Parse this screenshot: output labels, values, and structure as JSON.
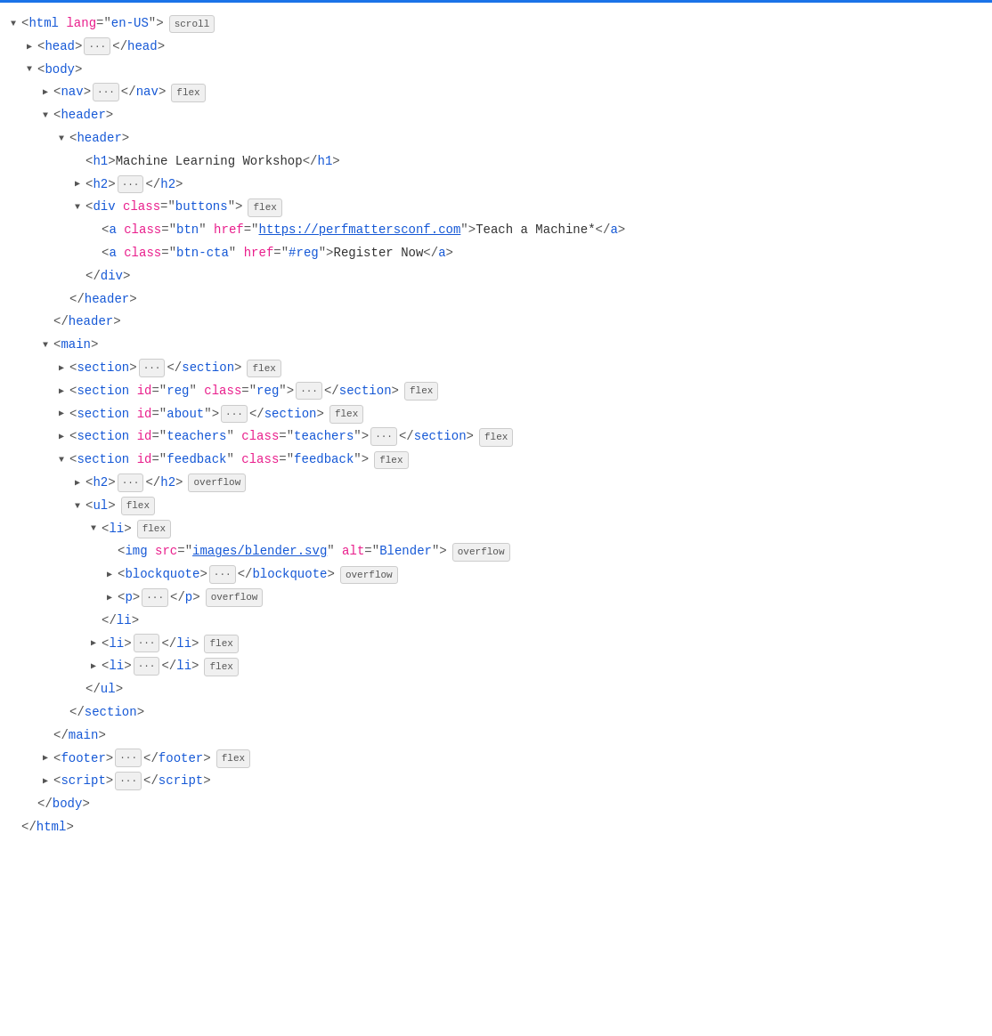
{
  "tree": {
    "lines": [
      {
        "id": "line-html",
        "indent": 0,
        "toggle": "down",
        "content": "html_open",
        "badge": "scroll"
      },
      {
        "id": "line-head",
        "indent": 1,
        "toggle": "right",
        "content": "head"
      },
      {
        "id": "line-body-open",
        "indent": 1,
        "toggle": "down",
        "content": "body_open"
      },
      {
        "id": "line-nav",
        "indent": 2,
        "toggle": "right",
        "content": "nav",
        "badge": "flex"
      },
      {
        "id": "line-outer-header-open",
        "indent": 2,
        "toggle": "down",
        "content": "outer_header_open"
      },
      {
        "id": "line-inner-header-open",
        "indent": 3,
        "toggle": "down",
        "content": "inner_header_open"
      },
      {
        "id": "line-h1",
        "indent": 4,
        "toggle": "none",
        "content": "h1"
      },
      {
        "id": "line-h2-collapsed",
        "indent": 4,
        "toggle": "right",
        "content": "h2_collapsed"
      },
      {
        "id": "line-div-buttons",
        "indent": 4,
        "toggle": "down",
        "content": "div_buttons",
        "badge": "flex"
      },
      {
        "id": "line-a-btn",
        "indent": 5,
        "toggle": "none",
        "content": "a_btn"
      },
      {
        "id": "line-a-btncta",
        "indent": 5,
        "toggle": "none",
        "content": "a_btncta"
      },
      {
        "id": "line-div-close",
        "indent": 4,
        "toggle": "none",
        "content": "div_close"
      },
      {
        "id": "line-inner-header-close",
        "indent": 3,
        "toggle": "none",
        "content": "inner_header_close"
      },
      {
        "id": "line-outer-header-close",
        "indent": 2,
        "toggle": "none",
        "content": "outer_header_close"
      },
      {
        "id": "line-main-open",
        "indent": 2,
        "toggle": "down",
        "content": "main_open"
      },
      {
        "id": "line-section1",
        "indent": 3,
        "toggle": "right",
        "content": "section1",
        "badge": "flex"
      },
      {
        "id": "line-section-reg",
        "indent": 3,
        "toggle": "right",
        "content": "section_reg",
        "badge": "flex"
      },
      {
        "id": "line-section-about",
        "indent": 3,
        "toggle": "right",
        "content": "section_about",
        "badge": "flex"
      },
      {
        "id": "line-section-teachers",
        "indent": 3,
        "toggle": "right",
        "content": "section_teachers",
        "badge": "flex"
      },
      {
        "id": "line-section-feedback",
        "indent": 3,
        "toggle": "down",
        "content": "section_feedback",
        "badge": "flex"
      },
      {
        "id": "line-h2-feedback",
        "indent": 4,
        "toggle": "right",
        "content": "h2_feedback",
        "badge": "overflow"
      },
      {
        "id": "line-ul",
        "indent": 4,
        "toggle": "down",
        "content": "ul",
        "badge": "flex"
      },
      {
        "id": "line-li-first",
        "indent": 5,
        "toggle": "down",
        "content": "li_first",
        "badge": "flex"
      },
      {
        "id": "line-img",
        "indent": 6,
        "toggle": "none",
        "content": "img",
        "badge": "overflow"
      },
      {
        "id": "line-blockquote",
        "indent": 6,
        "toggle": "right",
        "content": "blockquote",
        "badge": "overflow"
      },
      {
        "id": "line-p",
        "indent": 6,
        "toggle": "right",
        "content": "p_tag",
        "badge": "overflow"
      },
      {
        "id": "line-li-close",
        "indent": 5,
        "toggle": "none",
        "content": "li_close"
      },
      {
        "id": "line-li2",
        "indent": 5,
        "toggle": "right",
        "content": "li2",
        "badge": "flex"
      },
      {
        "id": "line-li3",
        "indent": 5,
        "toggle": "right",
        "content": "li3",
        "badge": "flex"
      },
      {
        "id": "line-ul-close",
        "indent": 4,
        "toggle": "none",
        "content": "ul_close"
      },
      {
        "id": "line-section-feedback-close",
        "indent": 3,
        "toggle": "none",
        "content": "section_feedback_close"
      },
      {
        "id": "line-main-close",
        "indent": 2,
        "toggle": "none",
        "content": "main_close"
      },
      {
        "id": "line-footer",
        "indent": 2,
        "toggle": "right",
        "content": "footer",
        "badge": "flex"
      },
      {
        "id": "line-script",
        "indent": 2,
        "toggle": "right",
        "content": "script_tag"
      },
      {
        "id": "line-body-close",
        "indent": 1,
        "toggle": "none",
        "content": "body_close"
      },
      {
        "id": "line-html-close",
        "indent": 0,
        "toggle": "none",
        "content": "html_close"
      }
    ]
  }
}
